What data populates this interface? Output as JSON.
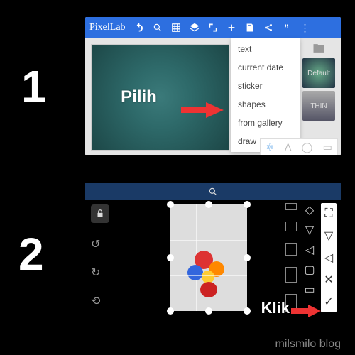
{
  "step1_number": "1",
  "step2_number": "2",
  "panel1": {
    "app_logo": "PixelLab",
    "canvas_label": "Pilih",
    "menu": {
      "text": "text",
      "current_date": "current date",
      "sticker": "sticker",
      "shapes": "shapes",
      "from_gallery": "from gallery",
      "draw": "draw"
    },
    "thumb1": "Default",
    "thumb2": "THIN"
  },
  "panel2": {
    "klik_label": "Klik"
  },
  "watermark": "milsmilo blog"
}
